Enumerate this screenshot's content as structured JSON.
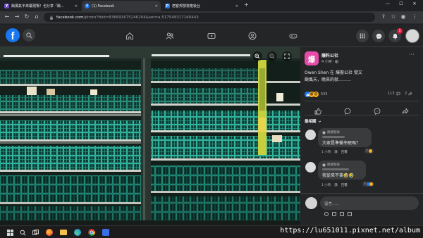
{
  "browser": {
    "tabs": [
      {
        "title": "颱風氣半來襲現場！也分享「颱...",
        "favicon_color": "#6a4bc4",
        "favicon_letter": "Y"
      },
      {
        "title": "(1) Facebook",
        "favicon_color": "#1877f2",
        "favicon_letter": "f"
      },
      {
        "title": "痞客邦部落格後台",
        "favicon_color": "#1a73e8",
        "favicon_letter": "P"
      }
    ],
    "url_domain": "facebook.com",
    "url_path": "/photo?fbid=836691675246204&set=a.517549317160443"
  },
  "facebook": {
    "logo": "f"
  },
  "post": {
    "page_name": "爆料公社",
    "time": "4 小時 · ",
    "author_line": "Owen Shen 在 爆廢公社 發文",
    "body": "颱風天，晚來的就………",
    "reaction_count": "535",
    "comment_count": "113",
    "share_count": "2",
    "sort_label": "最相關",
    "more_icon": "···"
  },
  "comments": [
    {
      "badge": "頭號粉絲",
      "text": "大家是準備冬眠嗎？",
      "time": "1 小時",
      "like": "讚",
      "reply": "回覆",
      "likes": "2"
    },
    {
      "badge": "頭號粉絲",
      "text": "我從來不搶🤣🤣",
      "time": "1 小時",
      "like": "讚",
      "reply": "回覆",
      "likes": "5"
    }
  ],
  "comment_input": {
    "placeholder": "留言......"
  },
  "watermark": "https://lu651011.pixnet.net/album",
  "colors": {
    "fb_blue": "#1877f2",
    "panel_bg": "#242526",
    "crate_teal": "#2fb59e",
    "notification_red": "#e41e3f"
  }
}
